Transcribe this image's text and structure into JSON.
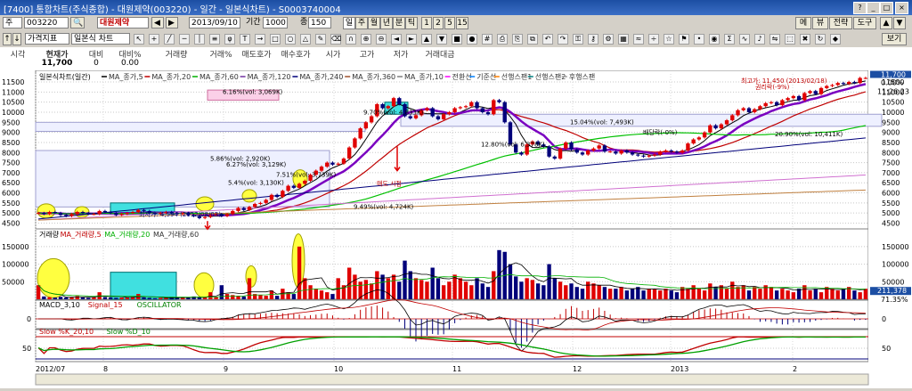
{
  "window": {
    "title": "[7400] 통합차트(주식종합) - 대원제약(003220) - 일간 - 일본식차트) - S0003740004",
    "controls": [
      "?",
      "_",
      "□",
      "×"
    ]
  },
  "toolbar1": {
    "market_label": "주",
    "code": "003220",
    "stock_name": "대원제약",
    "date": "2013/09/10",
    "period_label": "기간",
    "period_value": "1000",
    "count_label": "종",
    "count_value": "150",
    "units": [
      "일",
      "주",
      "월",
      "년",
      "분",
      "틱"
    ],
    "minute_options": [
      "1",
      "2",
      "5",
      "15"
    ],
    "right_buttons": [
      "메",
      "뷰",
      "전략",
      "도구"
    ]
  },
  "toolbar2": {
    "indicator_select": "가격지표",
    "chart_select": "일본식 차트",
    "view_button": "보기"
  },
  "quote": {
    "headers": [
      "시각",
      "현재가",
      "대비",
      "대비%",
      "거래량",
      "거래%",
      "매도호가",
      "매수호가",
      "시가",
      "고가",
      "저가",
      "거래대금"
    ],
    "values": [
      "",
      "11,700",
      "0",
      "0.00",
      "",
      "",
      "",
      "",
      "",
      "",
      "",
      ""
    ]
  },
  "chart_data": [
    {
      "type": "candlestick",
      "panel": "price",
      "title": "일본식차트(일간)",
      "legend": [
        "MA_종가,5",
        "MA_종가,20",
        "MA_종가,60",
        "MA_종가,120",
        "MA_종가,240",
        "MA_종가,360",
        "MA_종가,10",
        "전환선",
        "기준선",
        "선행스팬1",
        "선행스팬2",
        "후행스팬"
      ],
      "y_ticks": [
        11500,
        11000,
        10500,
        10000,
        9500,
        9000,
        8500,
        8000,
        7500,
        7000,
        6500,
        6000,
        5500,
        5000,
        4500
      ],
      "ylim": [
        4300,
        11900
      ],
      "current_price": "11,700",
      "current_pct": "0.00%",
      "current_time": "11:26:23",
      "x_labels": [
        "2012/07",
        "8",
        "9",
        "10",
        "11",
        "12",
        "2013",
        "2"
      ],
      "close": [
        5000,
        4950,
        5050,
        5000,
        4900,
        4850,
        4950,
        5050,
        5000,
        4950,
        4950,
        5100,
        5050,
        5000,
        4900,
        4950,
        5000,
        5050,
        5150,
        5100,
        5000,
        4950,
        5000,
        5050,
        5000,
        4950,
        5000,
        4900,
        4850,
        4750,
        4800,
        4900,
        4950,
        4850,
        4950,
        5100,
        5250,
        5150,
        5300,
        5450,
        5500,
        5650,
        5900,
        5800,
        6100,
        6350,
        6250,
        6450,
        6600,
        6900,
        7100,
        7300,
        7500,
        7400,
        7450,
        7700,
        8250,
        8700,
        9200,
        9500,
        9800,
        10400,
        10200,
        10300,
        10700,
        10400,
        9800,
        9700,
        9850,
        10100,
        10200,
        9800,
        9650,
        9900,
        10000,
        10200,
        10250,
        10300,
        10500,
        10200,
        10000,
        9900,
        10600,
        10500,
        9500,
        8400,
        8000,
        7900,
        8400,
        8550,
        8400,
        8300,
        7800,
        7700,
        8200,
        8500,
        8150,
        8000,
        7900,
        8100,
        8200,
        8350,
        8050,
        8050,
        7950,
        8100,
        8000,
        7900,
        7850,
        7800,
        7850,
        7900,
        8050,
        8100,
        8050,
        8000,
        8100,
        8450,
        8650,
        8750,
        9000,
        9350,
        9200,
        9400,
        9600,
        9850,
        10100,
        10200,
        10000,
        10150,
        10300,
        10450,
        10500,
        10350,
        10600,
        10700,
        10800,
        10600,
        10950,
        11050,
        10900,
        11200,
        11300,
        11350,
        11450,
        11400,
        11500,
        11450,
        11700,
        11700
      ],
      "annotations": [
        {
          "text": "6.16%(vol: 3,069K)"
        },
        {
          "text": "9.70%(vol: 4,833K)"
        },
        {
          "text": "5.86%(vol: 2,920K)"
        },
        {
          "text": "6.27%(vol: 3,129K)"
        },
        {
          "text": "7.51%(vol: 3,739K)"
        },
        {
          "text": "5.4%(vol: 3,130K)"
        },
        {
          "text": "최저가: 4,594 (2012/08/03)"
        },
        {
          "text": "9.49%(vol: 4,724K)"
        },
        {
          "text": "매도 시점"
        },
        {
          "text": "12.80%(vol: 6,378K)"
        },
        {
          "text": "15.04%(vol: 7,493K)"
        },
        {
          "text": "배당락(-0%)"
        },
        {
          "text": "20.90%(vol: 10,411K)"
        },
        {
          "text": "최고가: 11,450 (2013/02/18)"
        },
        {
          "text": "권리락(-9%)"
        }
      ]
    },
    {
      "type": "bar",
      "panel": "volume",
      "legend": [
        "거래량",
        "MA_거래량,5",
        "MA_거래량,20",
        "MA_거래량,60"
      ],
      "y_ticks": [
        150000,
        100000,
        50000
      ],
      "ylim": [
        0,
        175000
      ],
      "current_value": "211,378",
      "current_pct": "71.35%",
      "values": [
        40000,
        8000,
        6000,
        5000,
        7000,
        5000,
        6000,
        9000,
        5000,
        4000,
        5000,
        20000,
        6000,
        5000,
        4000,
        5000,
        6000,
        7000,
        15000,
        5000,
        4000,
        3000,
        4000,
        5000,
        6000,
        4000,
        5000,
        4000,
        8000,
        5000,
        6000,
        20000,
        7000,
        40000,
        15000,
        12000,
        10000,
        8000,
        60000,
        15000,
        12000,
        10000,
        25000,
        10000,
        30000,
        20000,
        15000,
        150000,
        60000,
        40000,
        30000,
        25000,
        20000,
        15000,
        60000,
        40000,
        90000,
        70000,
        50000,
        55000,
        45000,
        80000,
        70000,
        60000,
        70000,
        50000,
        110000,
        80000,
        60000,
        55000,
        50000,
        90000,
        60000,
        40000,
        50000,
        70000,
        60000,
        50000,
        40000,
        60000,
        45000,
        35000,
        80000,
        140000,
        135000,
        100000,
        65000,
        50000,
        60000,
        55000,
        45000,
        40000,
        100000,
        60000,
        50000,
        40000,
        45000,
        35000,
        30000,
        50000,
        45000,
        40000,
        35000,
        30000,
        30000,
        35000,
        25000,
        30000,
        35000,
        25000,
        30000,
        28000,
        25000,
        30000,
        25000,
        20000,
        35000,
        30000,
        40000,
        30000,
        25000,
        45000,
        35000,
        40000,
        30000,
        50000,
        35000,
        40000,
        25000,
        35000,
        30000,
        40000,
        35000,
        25000,
        30000,
        25000,
        20000,
        30000,
        40000,
        25000,
        30000,
        20000,
        35000,
        30000,
        25000,
        30000,
        35000,
        25000,
        20000,
        30000
      ]
    },
    {
      "type": "line",
      "panel": "macd",
      "legend": [
        "MACD_3,10",
        "Signal_15",
        "OSCILLATOR"
      ],
      "y_ticks": [
        0
      ]
    },
    {
      "type": "line",
      "panel": "stochastic",
      "legend": [
        "Slow %K_20,10",
        "Slow %D_10"
      ],
      "y_ticks": [
        50
      ]
    }
  ],
  "colors": {
    "up": "#e00000",
    "down": "#00007a",
    "accent": "#1c4ea3"
  }
}
